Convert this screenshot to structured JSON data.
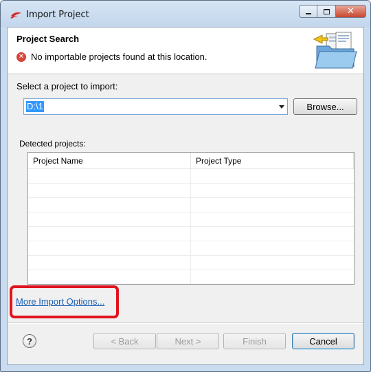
{
  "window": {
    "title": "Import Project",
    "app_icon": "silabs-logo-icon",
    "controls": [
      "minimize-icon",
      "maximize-icon",
      "close-icon"
    ]
  },
  "header": {
    "title": "Project Search",
    "message": "No importable projects found at this location.",
    "message_icon": "error-icon",
    "image": "import-folder-wizard-icon"
  },
  "selection": {
    "label": "Select a project to import:",
    "value": "D:\\1",
    "browse_label": "Browse..."
  },
  "detected": {
    "label": "Detected projects:",
    "columns": [
      "Project Name",
      "Project Type"
    ],
    "rows": []
  },
  "more_options_link": "More Import Options...",
  "footer": {
    "help_label": "?",
    "back_label": "< Back",
    "next_label": "Next >",
    "finish_label": "Finish",
    "cancel_label": "Cancel"
  },
  "colors": {
    "highlight": "#e0141e",
    "link": "#1b5fb5",
    "selection": "#3399ff",
    "error": "#d9453a"
  }
}
